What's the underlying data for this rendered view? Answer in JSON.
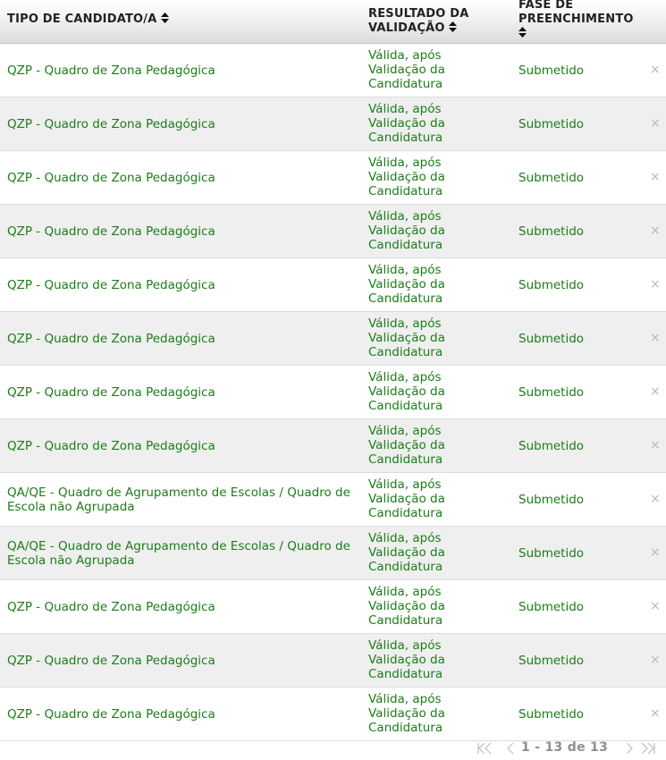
{
  "header": {
    "col_tipo": "TIPO DE CANDIDATO/A",
    "col_resultado_line1": "RESULTADO DA",
    "col_resultado_line2": "VALIDAÇÃO",
    "col_fase_line1": "FASE DE",
    "col_fase_line2": "PREENCHIMENTO"
  },
  "rows": [
    {
      "tipo": "QZP - Quadro de Zona Pedagógica",
      "resultado": "Válida, após Validação da Candidatura",
      "fase": "Submetido",
      "remove": "×"
    },
    {
      "tipo": "QZP - Quadro de Zona Pedagógica",
      "resultado": "Válida, após Validação da Candidatura",
      "fase": "Submetido",
      "remove": "×"
    },
    {
      "tipo": "QZP - Quadro de Zona Pedagógica",
      "resultado": "Válida, após Validação da Candidatura",
      "fase": "Submetido",
      "remove": "×"
    },
    {
      "tipo": "QZP - Quadro de Zona Pedagógica",
      "resultado": "Válida, após Validação da Candidatura",
      "fase": "Submetido",
      "remove": "×"
    },
    {
      "tipo": "QZP - Quadro de Zona Pedagógica",
      "resultado": "Válida, após Validação da Candidatura",
      "fase": "Submetido",
      "remove": "×"
    },
    {
      "tipo": "QZP - Quadro de Zona Pedagógica",
      "resultado": "Válida, após Validação da Candidatura",
      "fase": "Submetido",
      "remove": "×"
    },
    {
      "tipo": "QZP - Quadro de Zona Pedagógica",
      "resultado": "Válida, após Validação da Candidatura",
      "fase": "Submetido",
      "remove": "×"
    },
    {
      "tipo": "QZP - Quadro de Zona Pedagógica",
      "resultado": "Válida, após Validação da Candidatura",
      "fase": "Submetido",
      "remove": "×"
    },
    {
      "tipo": "QA/QE - Quadro de Agrupamento de Escolas / Quadro de Escola não Agrupada",
      "resultado": "Válida, após Validação da Candidatura",
      "fase": "Submetido",
      "remove": "×"
    },
    {
      "tipo": "QA/QE - Quadro de Agrupamento de Escolas / Quadro de Escola não Agrupada",
      "resultado": "Válida, após Validação da Candidatura",
      "fase": "Submetido",
      "remove": "×"
    },
    {
      "tipo": "QZP - Quadro de Zona Pedagógica",
      "resultado": "Válida, após Validação da Candidatura",
      "fase": "Submetido",
      "remove": "×"
    },
    {
      "tipo": "QZP - Quadro de Zona Pedagógica",
      "resultado": "Válida, após Validação da Candidatura",
      "fase": "Submetido",
      "remove": "×"
    },
    {
      "tipo": "QZP - Quadro de Zona Pedagógica",
      "resultado": "Válida, após Validação da Candidatura",
      "fase": "Submetido",
      "remove": "×"
    }
  ],
  "pager": {
    "info": "1 - 13 de 13",
    "icons": [
      "first-page-icon",
      "prev-page-icon",
      "next-page-icon",
      "last-page-icon"
    ]
  },
  "colors": {
    "text_green": "#1b7d18",
    "row_alt": "#efefef",
    "pager_grey": "#8a8a8a"
  }
}
